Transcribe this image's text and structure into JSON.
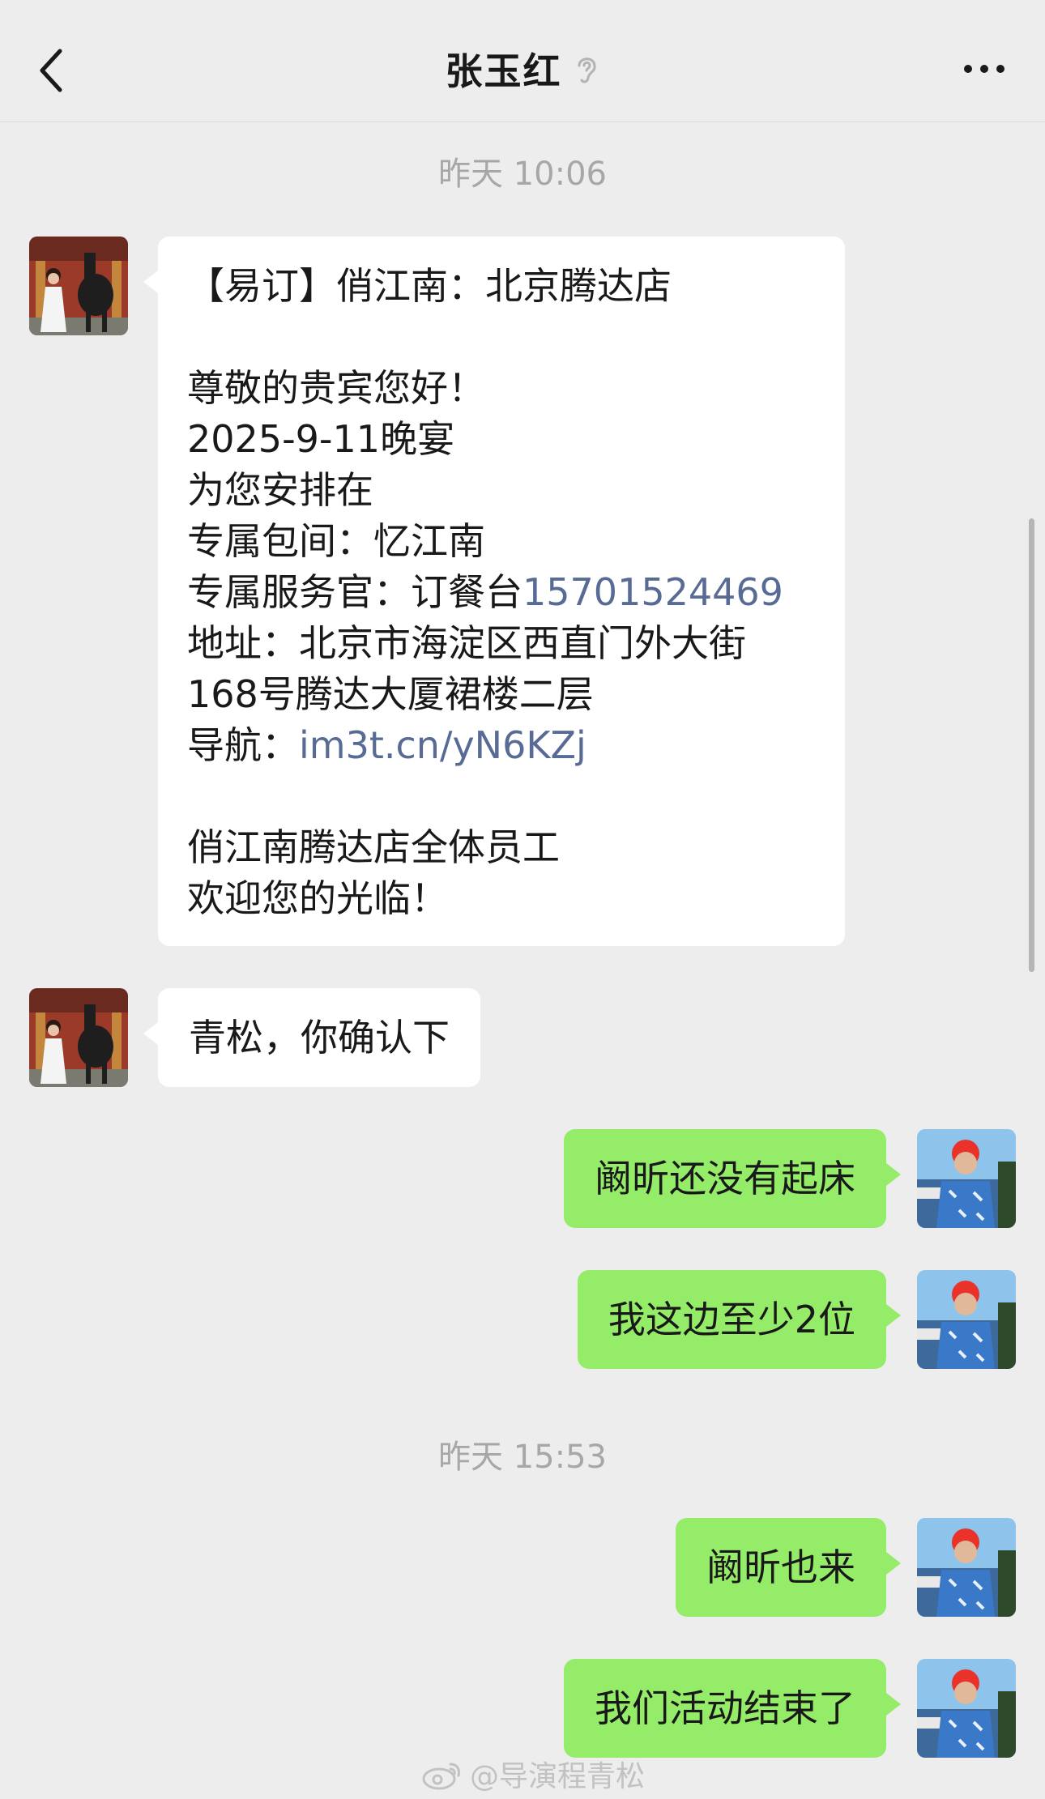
{
  "header": {
    "title": "张玉红"
  },
  "timestamps": [
    "昨天 10:06",
    "昨天 15:53"
  ],
  "messages": [
    {
      "side": "in",
      "lines": [
        "【易订】俏江南：北京腾达店",
        "",
        "尊敬的贵宾您好！",
        "2025-9-11晚宴",
        "为您安排在",
        "专属包间：忆江南",
        "专属服务官：订餐台",
        "地址：北京市海淀区西直门外大街",
        "168号腾达大厦裙楼二层",
        "导航：",
        "",
        "俏江南腾达店全体员工",
        "欢迎您的光临！"
      ],
      "phone_link": "15701524469",
      "nav_link": "im3t.cn/yN6KZj"
    },
    {
      "side": "in",
      "text": "青松，你确认下"
    },
    {
      "side": "out",
      "text": "阚昕还没有起床"
    },
    {
      "side": "out",
      "text": "我这边至少2位"
    },
    {
      "side": "out",
      "text": "阚昕也来"
    },
    {
      "side": "out",
      "text": "我们活动结束了"
    }
  ],
  "watermark": "@导演程青松",
  "colors": {
    "background": "#ededed",
    "incoming_bubble": "#ffffff",
    "outgoing_bubble": "#95ec69",
    "link": "#576b95",
    "timestamp": "#a7a7a7"
  }
}
